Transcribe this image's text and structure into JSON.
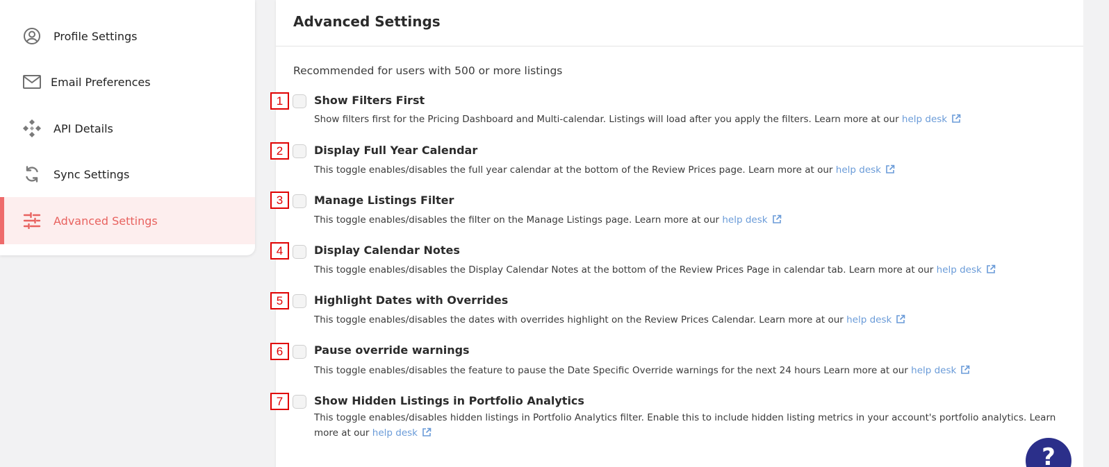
{
  "sidebar": {
    "items": [
      {
        "label": "Profile Settings",
        "icon": "user-circle-icon",
        "active": false
      },
      {
        "label": "Email Preferences",
        "icon": "envelope-icon",
        "active": false
      },
      {
        "label": "API Details",
        "icon": "api-diamond-icon",
        "active": false
      },
      {
        "label": "Sync Settings",
        "icon": "sync-icon",
        "active": false
      },
      {
        "label": "Advanced Settings",
        "icon": "sliders-icon",
        "active": true
      }
    ]
  },
  "main": {
    "title": "Advanced Settings",
    "subtitle": "Recommended for users with 500 or more listings",
    "help_link_label": "help desk",
    "settings": [
      {
        "number": "1",
        "title": "Show Filters First",
        "description": "Show filters first for the Pricing Dashboard and Multi-calendar. Listings will load after you apply the filters. Learn more at our",
        "link": "help desk",
        "checked": false
      },
      {
        "number": "2",
        "title": "Display Full Year Calendar",
        "description": "This toggle enables/disables the full year calendar at the bottom of the Review Prices page. Learn more at our",
        "link": "help desk",
        "checked": false
      },
      {
        "number": "3",
        "title": "Manage Listings Filter",
        "description": "This toggle enables/disables the filter on the Manage Listings page. Learn more at our",
        "link": "help desk",
        "checked": false
      },
      {
        "number": "4",
        "title": "Display Calendar Notes",
        "description": "This toggle enables/disables the Display Calendar Notes at the bottom of the Review Prices Page in calendar tab. Learn more at our",
        "link": "help desk",
        "checked": false
      },
      {
        "number": "5",
        "title": "Highlight Dates with Overrides",
        "description": "This toggle enables/disables the dates with overrides highlight on the Review Prices Calendar. Learn more at our",
        "link": "help desk",
        "checked": false
      },
      {
        "number": "6",
        "title": "Pause override warnings",
        "description": "This toggle enables/disables the feature to pause the Date Specific Override warnings for the next 24 hours Learn more at our",
        "link": "help desk",
        "checked": false
      },
      {
        "number": "7",
        "title": "Show Hidden Listings in Portfolio Analytics",
        "description": "This toggle enables/disables hidden listings in Portfolio Analytics filter. Enable this to include hidden listing metrics in your account's portfolio analytics. Learn more at our",
        "link": "help desk",
        "checked": false
      }
    ]
  },
  "help_fab": {
    "label": "?"
  },
  "colors": {
    "accent": "#e8625f",
    "active_bg": "#fdeeee",
    "link": "#6a9bd8",
    "badge": "#e00000",
    "fab": "#2b2f8a"
  }
}
